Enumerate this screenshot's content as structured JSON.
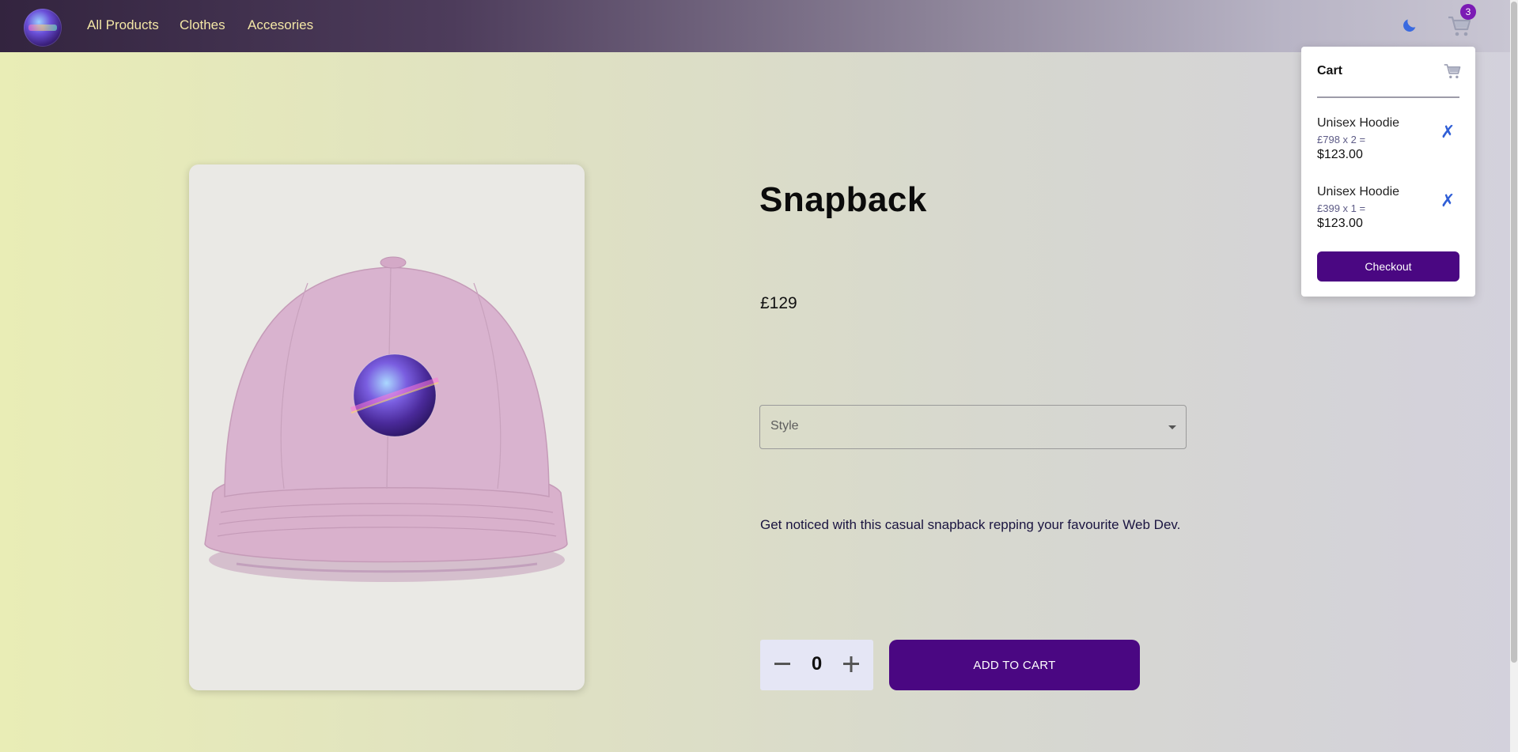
{
  "nav": {
    "links": [
      "All Products",
      "Clothes",
      "Accesories"
    ],
    "cart_count": "3",
    "theme_icon": "moon-icon",
    "cart_icon": "cart-icon"
  },
  "product": {
    "title": "Snapback",
    "price": "£129",
    "style_placeholder": "Style",
    "description": "Get noticed with this casual snapback repping your favourite Web Dev.",
    "quantity": "0",
    "add_to_cart_label": "ADD TO CART",
    "image_colors": {
      "cap": "#d9b3cf",
      "card": "#eae9e5"
    }
  },
  "cart": {
    "title": "Cart",
    "items": [
      {
        "name": "Unisex Hoodie",
        "qty_line": "£798 x 2 =",
        "total": "$123.00"
      },
      {
        "name": "Unisex Hoodie",
        "qty_line": "£399 x 1 =",
        "total": "$123.00"
      }
    ],
    "checkout_label": "Checkout"
  },
  "colors": {
    "accent": "#4a0782",
    "nav_text": "#f4e7a6",
    "remove": "#2f5ed6",
    "badge": "#7b1bb4"
  }
}
